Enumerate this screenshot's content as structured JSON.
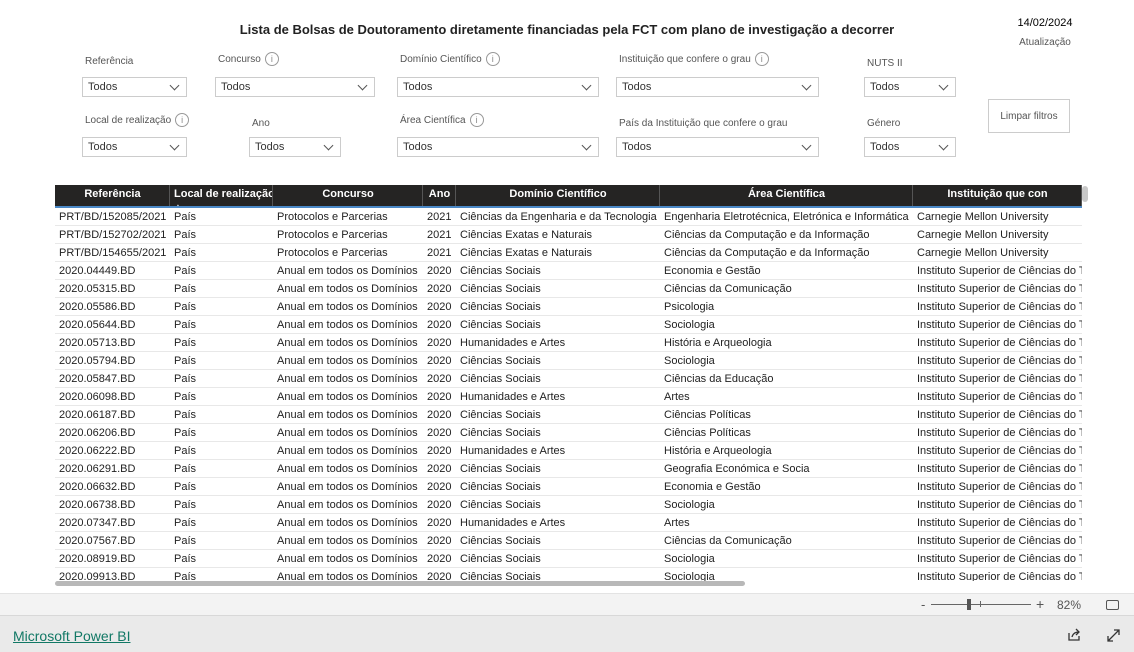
{
  "header": {
    "title": "Lista de Bolsas de Doutoramento  diretamente financiadas pela FCT com plano de investigação a decorrer",
    "date": "14/02/2024",
    "date_label": "Atualização"
  },
  "filters": [
    {
      "label": "Referência",
      "value": "Todos",
      "info": false
    },
    {
      "label": "Concurso",
      "value": "Todos",
      "info": true
    },
    {
      "label": "Domínio Científico",
      "value": "Todos",
      "info": true
    },
    {
      "label": "Instituição que confere o grau",
      "value": "Todos",
      "info": true
    },
    {
      "label": "NUTS II",
      "value": "Todos",
      "info": false
    },
    {
      "label": "Local de realização",
      "value": "Todos",
      "info": true
    },
    {
      "label": "Ano",
      "value": "Todos",
      "info": false
    },
    {
      "label": "Área Científica",
      "value": "Todos",
      "info": true
    },
    {
      "label": "País da Instituição que confere o grau",
      "value": "Todos",
      "info": false
    },
    {
      "label": "Género",
      "value": "Todos",
      "info": false
    }
  ],
  "clear_filters": "Limpar filtros",
  "table": {
    "columns": [
      "Referência",
      "Local de realização",
      "Concurso",
      "Ano",
      "Domínio Científico",
      "Área Científica",
      "Instituição que con"
    ],
    "sorted_column": 1,
    "rows": [
      [
        "PRT/BD/152085/2021",
        "País",
        "Protocolos e Parcerias",
        "2021",
        "Ciências da Engenharia e da Tecnologia",
        "Engenharia Eletrotécnica, Eletrónica e Informática",
        "Carnegie Mellon University"
      ],
      [
        "PRT/BD/152702/2021",
        "País",
        "Protocolos e Parcerias",
        "2021",
        "Ciências Exatas e Naturais",
        "Ciências da Computação e da Informação",
        "Carnegie Mellon University"
      ],
      [
        "PRT/BD/154655/2021",
        "País",
        "Protocolos e Parcerias",
        "2021",
        "Ciências Exatas e Naturais",
        "Ciências da Computação e da Informação",
        "Carnegie Mellon University"
      ],
      [
        "2020.04449.BD",
        "País",
        "Anual em todos os Domínios",
        "2020",
        "Ciências Sociais",
        "Economia e Gestão",
        "Instituto Superior de Ciências do T"
      ],
      [
        "2020.05315.BD",
        "País",
        "Anual em todos os Domínios",
        "2020",
        "Ciências Sociais",
        "Ciências da Comunicação",
        "Instituto Superior de Ciências do T"
      ],
      [
        "2020.05586.BD",
        "País",
        "Anual em todos os Domínios",
        "2020",
        "Ciências Sociais",
        "Psicologia",
        "Instituto Superior de Ciências do T"
      ],
      [
        "2020.05644.BD",
        "País",
        "Anual em todos os Domínios",
        "2020",
        "Ciências Sociais",
        "Sociologia",
        "Instituto Superior de Ciências do T"
      ],
      [
        "2020.05713.BD",
        "País",
        "Anual em todos os Domínios",
        "2020",
        "Humanidades e Artes",
        "História e Arqueologia",
        "Instituto Superior de Ciências do T"
      ],
      [
        "2020.05794.BD",
        "País",
        "Anual em todos os Domínios",
        "2020",
        "Ciências Sociais",
        "Sociologia",
        "Instituto Superior de Ciências do T"
      ],
      [
        "2020.05847.BD",
        "País",
        "Anual em todos os Domínios",
        "2020",
        "Ciências Sociais",
        "Ciências da Educação",
        "Instituto Superior de Ciências do T"
      ],
      [
        "2020.06098.BD",
        "País",
        "Anual em todos os Domínios",
        "2020",
        "Humanidades e Artes",
        "Artes",
        "Instituto Superior de Ciências do T"
      ],
      [
        "2020.06187.BD",
        "País",
        "Anual em todos os Domínios",
        "2020",
        "Ciências Sociais",
        "Ciências Políticas",
        "Instituto Superior de Ciências do T"
      ],
      [
        "2020.06206.BD",
        "País",
        "Anual em todos os Domínios",
        "2020",
        "Ciências Sociais",
        "Ciências Políticas",
        "Instituto Superior de Ciências do T"
      ],
      [
        "2020.06222.BD",
        "País",
        "Anual em todos os Domínios",
        "2020",
        "Humanidades e Artes",
        "História e Arqueologia",
        "Instituto Superior de Ciências do T"
      ],
      [
        "2020.06291.BD",
        "País",
        "Anual em todos os Domínios",
        "2020",
        "Ciências Sociais",
        "Geografia Económica e Socia",
        "Instituto Superior de Ciências do T"
      ],
      [
        "2020.06632.BD",
        "País",
        "Anual em todos os Domínios",
        "2020",
        "Ciências Sociais",
        "Economia e Gestão",
        "Instituto Superior de Ciências do T"
      ],
      [
        "2020.06738.BD",
        "País",
        "Anual em todos os Domínios",
        "2020",
        "Ciências Sociais",
        "Sociologia",
        "Instituto Superior de Ciências do T"
      ],
      [
        "2020.07347.BD",
        "País",
        "Anual em todos os Domínios",
        "2020",
        "Humanidades e Artes",
        "Artes",
        "Instituto Superior de Ciências do T"
      ],
      [
        "2020.07567.BD",
        "País",
        "Anual em todos os Domínios",
        "2020",
        "Ciências Sociais",
        "Ciências da Comunicação",
        "Instituto Superior de Ciências do T"
      ],
      [
        "2020.08919.BD",
        "País",
        "Anual em todos os Domínios",
        "2020",
        "Ciências Sociais",
        "Sociologia",
        "Instituto Superior de Ciências do T"
      ],
      [
        "2020.09913.BD",
        "País",
        "Anual em todos os Domínios",
        "2020",
        "Ciências Sociais",
        "Sociologia",
        "Instituto Superior de Ciências do T"
      ]
    ]
  },
  "zoom": {
    "minus": "-",
    "plus": "+",
    "level": "82%",
    "level_value": 82
  },
  "footer": {
    "brand": "Microsoft Power BI"
  },
  "icons": {
    "share": "share-icon",
    "fullscreen": "expand-icon",
    "fit": "fit-to-page-icon",
    "info": "info-icon"
  }
}
